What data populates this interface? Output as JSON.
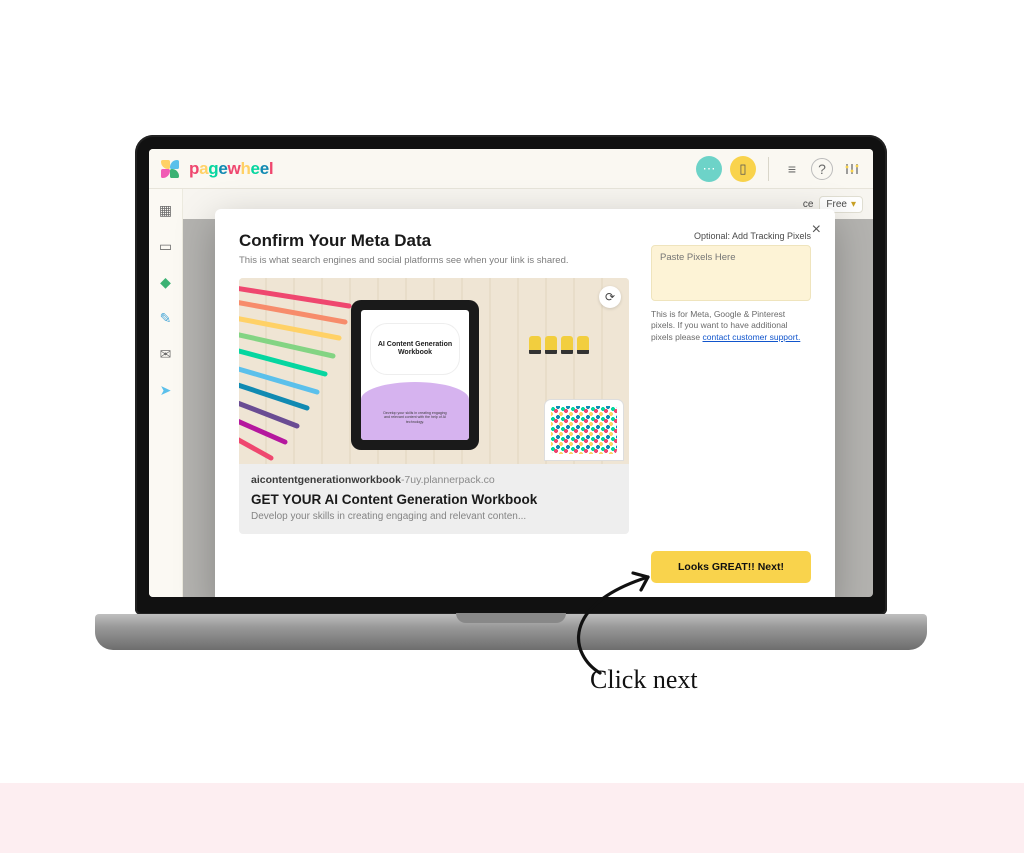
{
  "header": {
    "brand": "pagewheel",
    "free_label": "Free",
    "search_label": "ce"
  },
  "modal": {
    "title": "Confirm Your Meta Data",
    "subtitle": "This is what search engines and social platforms see when your link is shared.",
    "tablet_title": "AI Content Generation Workbook",
    "tablet_sub": "Develop your skills in creating engaging and relevant content with the help of AI technology.",
    "slug_bold": "aicontentgenerationworkbook",
    "slug_suffix": "-7uy.plannerpack.co",
    "preview_title": "GET YOUR AI Content Generation Workbook",
    "preview_desc": "Develop your skills in creating engaging and relevant conten...",
    "pixel_optional_label": "Optional: Add Tracking Pixels",
    "pixel_placeholder": "Paste Pixels Here",
    "pixel_help_text": "This is for Meta, Google & Pinterest pixels. If you want to have additional pixels please ",
    "pixel_help_link": "contact customer support.",
    "next_button": "Looks GREAT!! Next!"
  },
  "annotation": {
    "text": "Click next"
  }
}
